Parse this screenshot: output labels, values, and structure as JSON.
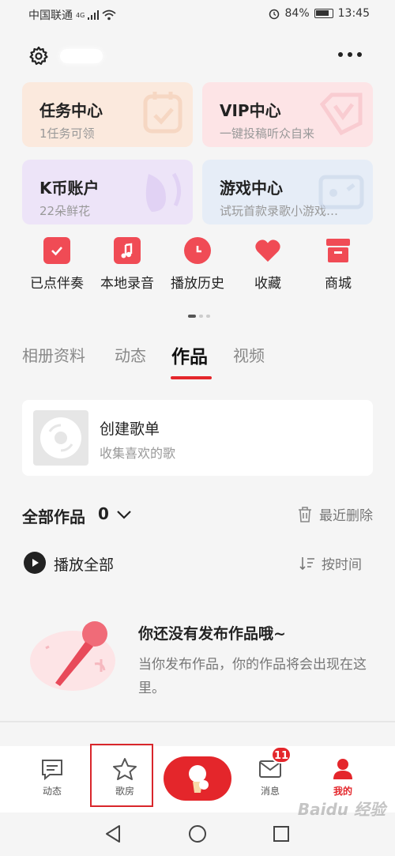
{
  "status_bar": {
    "carrier": "中国联通",
    "network": "4G",
    "battery": "84%",
    "time": "13:45"
  },
  "cards": [
    {
      "title": "任务中心",
      "subtitle": "1任务可领",
      "bg": "#fbe9dd"
    },
    {
      "title": "VIP中心",
      "subtitle": "一键投稿听众自来",
      "bg": "#fde4e6"
    },
    {
      "title": "K币账户",
      "subtitle": "22朵鲜花",
      "bg": "#ede4f8"
    },
    {
      "title": "游戏中心",
      "subtitle": "试玩首款录歌小游戏…",
      "bg": "#e6edf7"
    }
  ],
  "shortcuts": [
    {
      "label": "已点伴奏",
      "icon": "checkmark-icon"
    },
    {
      "label": "本地录音",
      "icon": "music-note-icon"
    },
    {
      "label": "播放历史",
      "icon": "clock-icon"
    },
    {
      "label": "收藏",
      "icon": "heart-icon"
    },
    {
      "label": "商城",
      "icon": "store-icon"
    }
  ],
  "tabs": [
    "相册资料",
    "动态",
    "作品",
    "视频"
  ],
  "active_tab": "作品",
  "playlist": {
    "title": "创建歌单",
    "subtitle": "收集喜欢的歌"
  },
  "works": {
    "title": "全部作品",
    "count": "0",
    "recent_delete": "最近删除"
  },
  "play": {
    "play_all": "播放全部",
    "sort": "按时间"
  },
  "empty": {
    "title": "你还没有发布作品哦~",
    "desc": "当你发布作品，你的作品将会出现在这里。"
  },
  "bottom_nav": {
    "items": [
      {
        "label": "动态",
        "icon": "feed-icon"
      },
      {
        "label": "歌房",
        "icon": "star-icon"
      },
      {
        "label": "消息",
        "icon": "mail-icon"
      },
      {
        "label": "我的",
        "icon": "person-icon"
      }
    ],
    "message_badge": "11",
    "active": "我的"
  },
  "accent_color": "#e4262b",
  "watermark": "Baidu 经验"
}
